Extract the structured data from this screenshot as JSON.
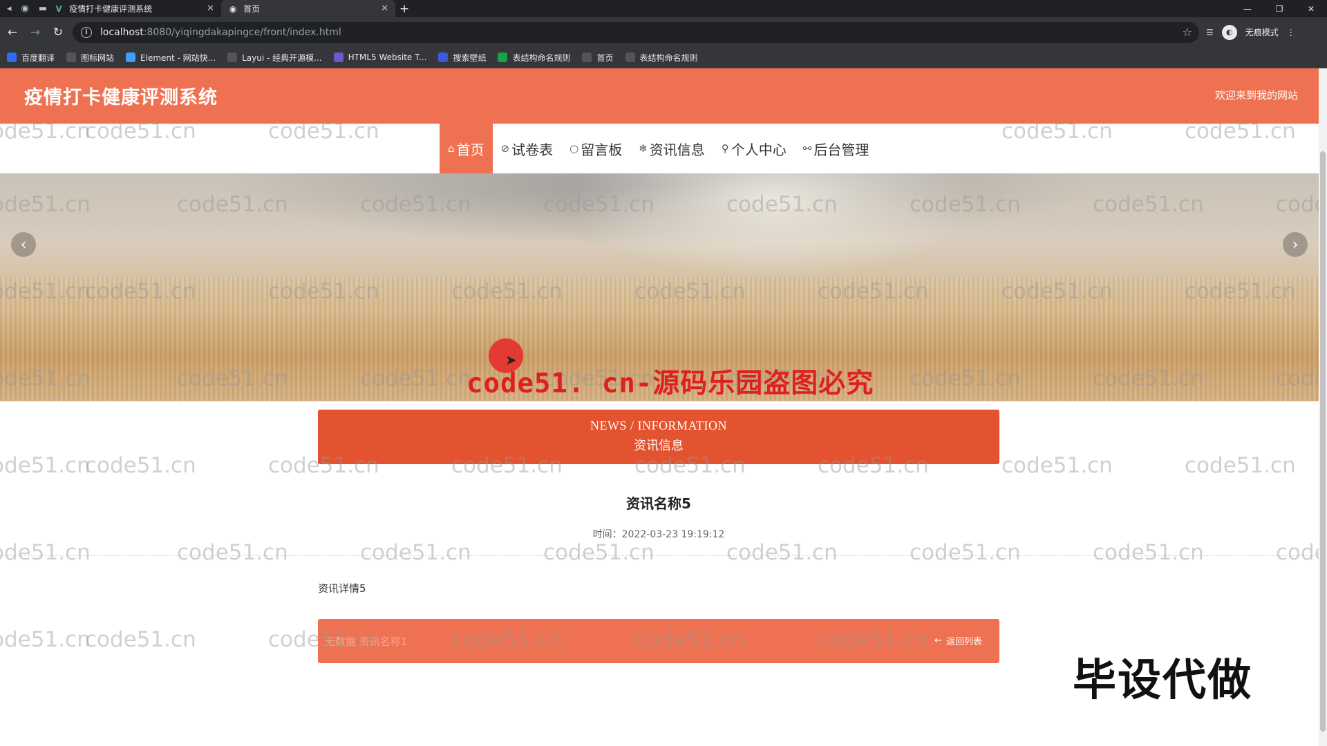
{
  "browser": {
    "tabs": [
      {
        "title": "疫情打卡健康评测系统",
        "icon": "vue-logo-icon",
        "active": false
      },
      {
        "title": "首页",
        "icon": "globe-icon",
        "active": true
      }
    ],
    "url_host": "localhost",
    "url_path": ":8080/yiqingdakapingce/front/index.html",
    "profile_label": "无痕模式",
    "bookmarks": [
      {
        "label": "百度翻译",
        "color": "#2f6df6"
      },
      {
        "label": "图标网站",
        "color": "#555555"
      },
      {
        "label": "Element - 网站快...",
        "color": "#409eff"
      },
      {
        "label": "Layui - 经典开源模...",
        "color": "#555555"
      },
      {
        "label": "HTML5 Website T...",
        "color": "#6a5acd"
      },
      {
        "label": "搜索壁纸",
        "color": "#3b5bdb"
      },
      {
        "label": "表结构命名规则",
        "color": "#16a34a"
      },
      {
        "label": "首页",
        "color": "#555555"
      },
      {
        "label": "表结构命名规则",
        "color": "#555555"
      }
    ]
  },
  "site": {
    "title": "疫情打卡健康评测系统",
    "welcome": "欢迎来到我的网站",
    "brand_color": "#ee7251",
    "accent_color": "#e4532f"
  },
  "nav": [
    {
      "label": "首页",
      "icon": "home-icon",
      "glyph": "⌂",
      "active": true
    },
    {
      "label": "试卷表",
      "icon": "paper-icon",
      "glyph": "⊘",
      "active": false
    },
    {
      "label": "留言板",
      "icon": "message-icon",
      "glyph": "○",
      "active": false
    },
    {
      "label": "资讯信息",
      "icon": "news-icon",
      "glyph": "❄",
      "active": false
    },
    {
      "label": "个人中心",
      "icon": "user-icon",
      "glyph": "⚲",
      "active": false
    },
    {
      "label": "后台管理",
      "icon": "link-icon",
      "glyph": "⚯",
      "active": false
    }
  ],
  "overlay_text": "code51. cn-源码乐园盗图必究",
  "section": {
    "en": "NEWS / INFORMATION",
    "cn": "资讯信息"
  },
  "article": {
    "title": "资讯名称5",
    "time": "时间：2022-03-23 19:19:12",
    "body": "资讯详情5"
  },
  "footer": {
    "pager": "无数据  资讯名称1",
    "back": "返回列表"
  },
  "watermark_text": "code51.cn",
  "stamp_text": "毕设代做"
}
